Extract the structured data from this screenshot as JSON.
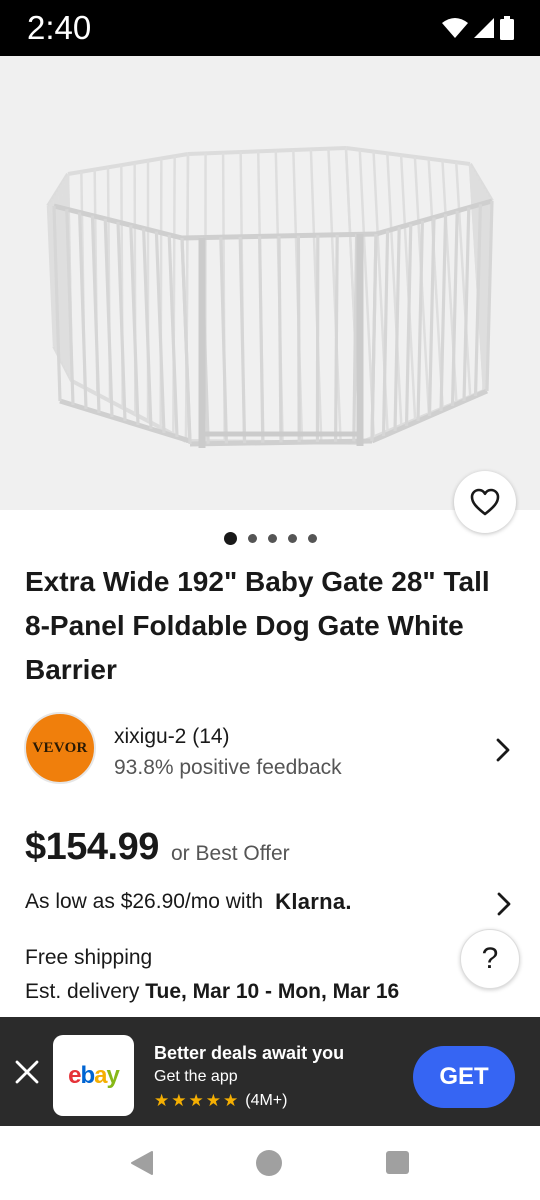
{
  "status_bar": {
    "time": "2:40"
  },
  "product": {
    "image_alt": "",
    "carousel": {
      "count": 5,
      "active": 0
    },
    "title": "Extra Wide 192\" Baby Gate 28\" Tall 8-Panel Foldable Dog Gate White Barrier"
  },
  "seller": {
    "avatar_text": "VEVOR",
    "name": "xixigu-2 (14)",
    "feedback": "93.8% positive feedback"
  },
  "pricing": {
    "price": "$154.99",
    "best_offer": "or Best Offer",
    "klarna_text": "As low as $26.90/mo with",
    "klarna_logo": "Klarna."
  },
  "shipping": {
    "free_shipping": "Free shipping",
    "est_prefix": "Est. delivery",
    "est_dates": "Tue, Mar 10 - Mon, Mar 16"
  },
  "help": {
    "label": "?"
  },
  "app_banner": {
    "headline": "Better deals await you",
    "subtext": "Get the app",
    "stars": 5,
    "rating_count": "(4M+)",
    "get_label": "GET"
  },
  "colors": {
    "accent_blue": "#3665f3",
    "avatar_orange": "#f07f0c",
    "banner_bg": "#2b2b2b",
    "star_gold": "#f5af02"
  },
  "icons": [
    "wifi-icon",
    "signal-icon",
    "battery-icon",
    "heart-icon",
    "chevron-right-icon",
    "close-icon",
    "star-icon",
    "back-icon",
    "home-icon",
    "recents-icon"
  ]
}
